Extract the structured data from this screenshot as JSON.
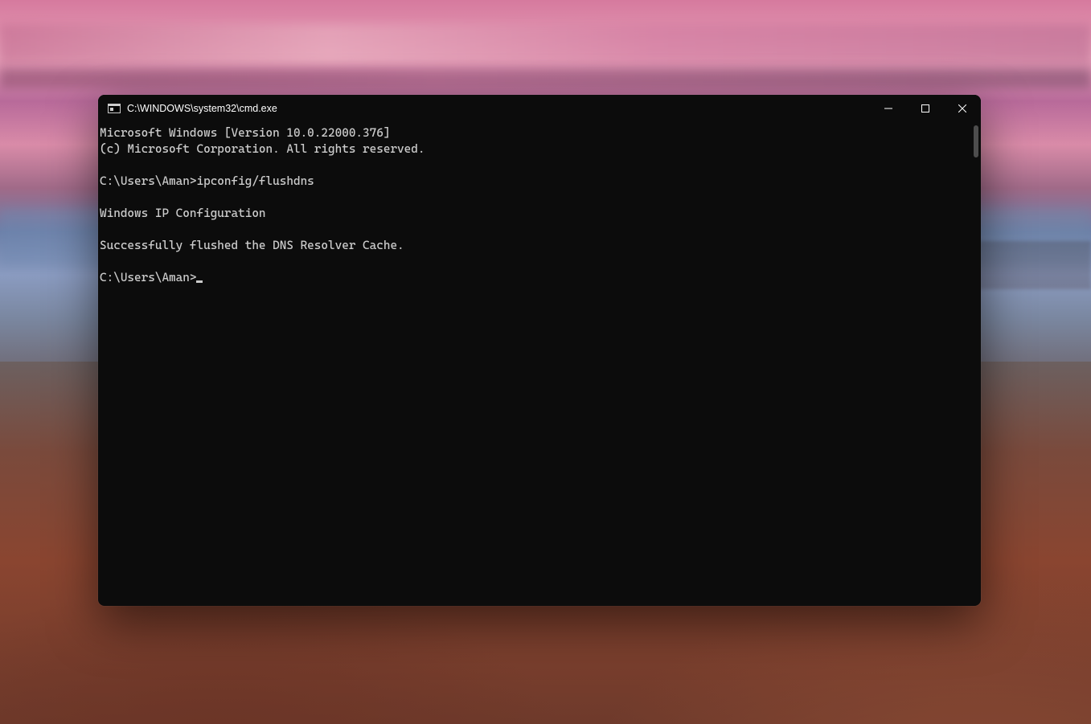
{
  "window": {
    "title": "C:\\WINDOWS\\system32\\cmd.exe"
  },
  "terminal": {
    "lines": [
      "Microsoft Windows [Version 10.0.22000.376]",
      "(c) Microsoft Corporation. All rights reserved.",
      "",
      "C:\\Users\\Aman>ipconfig/flushdns",
      "",
      "Windows IP Configuration",
      "",
      "Successfully flushed the DNS Resolver Cache.",
      "",
      "C:\\Users\\Aman>"
    ],
    "prompt": "C:\\Users\\Aman>",
    "last_command": "ipconfig/flushdns"
  },
  "controls": {
    "minimize": "Minimize",
    "maximize": "Maximize",
    "close": "Close"
  }
}
